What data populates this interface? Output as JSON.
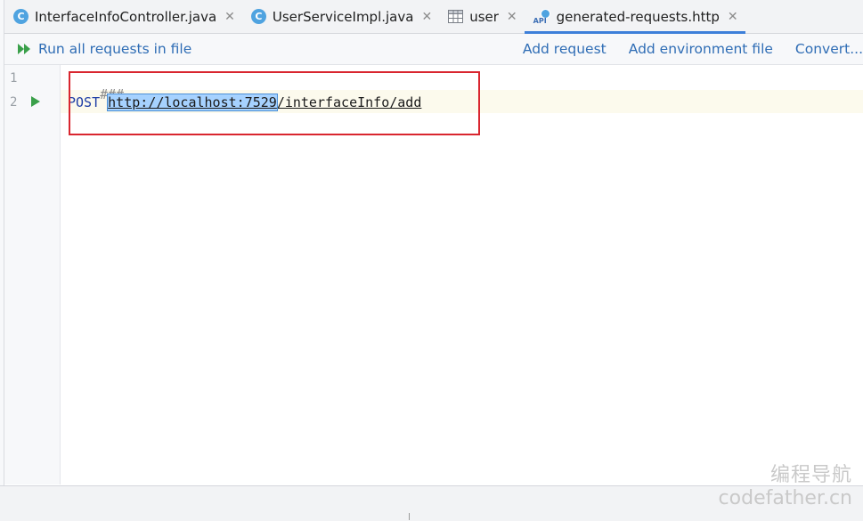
{
  "tabs": [
    {
      "label": "InterfaceInfoController.java",
      "icon": "class-icon",
      "active": false
    },
    {
      "label": "UserServiceImpl.java",
      "icon": "class-icon",
      "active": false
    },
    {
      "label": "user",
      "icon": "table-icon",
      "active": false
    },
    {
      "label": "generated-requests.http",
      "icon": "api-icon",
      "active": true
    }
  ],
  "class_icon_letter": "C",
  "api_icon_text": "API",
  "close_glyph": "✕",
  "toolbar": {
    "run_all_label": "Run all requests in file",
    "add_request_label": "Add request",
    "add_env_label": "Add environment file",
    "convert_label": "Convert..."
  },
  "editor": {
    "line_numbers": [
      "1",
      "2"
    ],
    "line1": "###",
    "line2_method": "POST",
    "line2_host": "http://localhost:7529",
    "line2_path": "/interfaceInfo/add"
  },
  "watermark": {
    "cn": "编程导航",
    "en": "codefather.cn"
  },
  "colors": {
    "accent": "#3d7fd9",
    "link": "#2f6db5",
    "run_green": "#3aa04a",
    "highlight_box": "#d9262f",
    "selection": "#a6d2ff"
  }
}
